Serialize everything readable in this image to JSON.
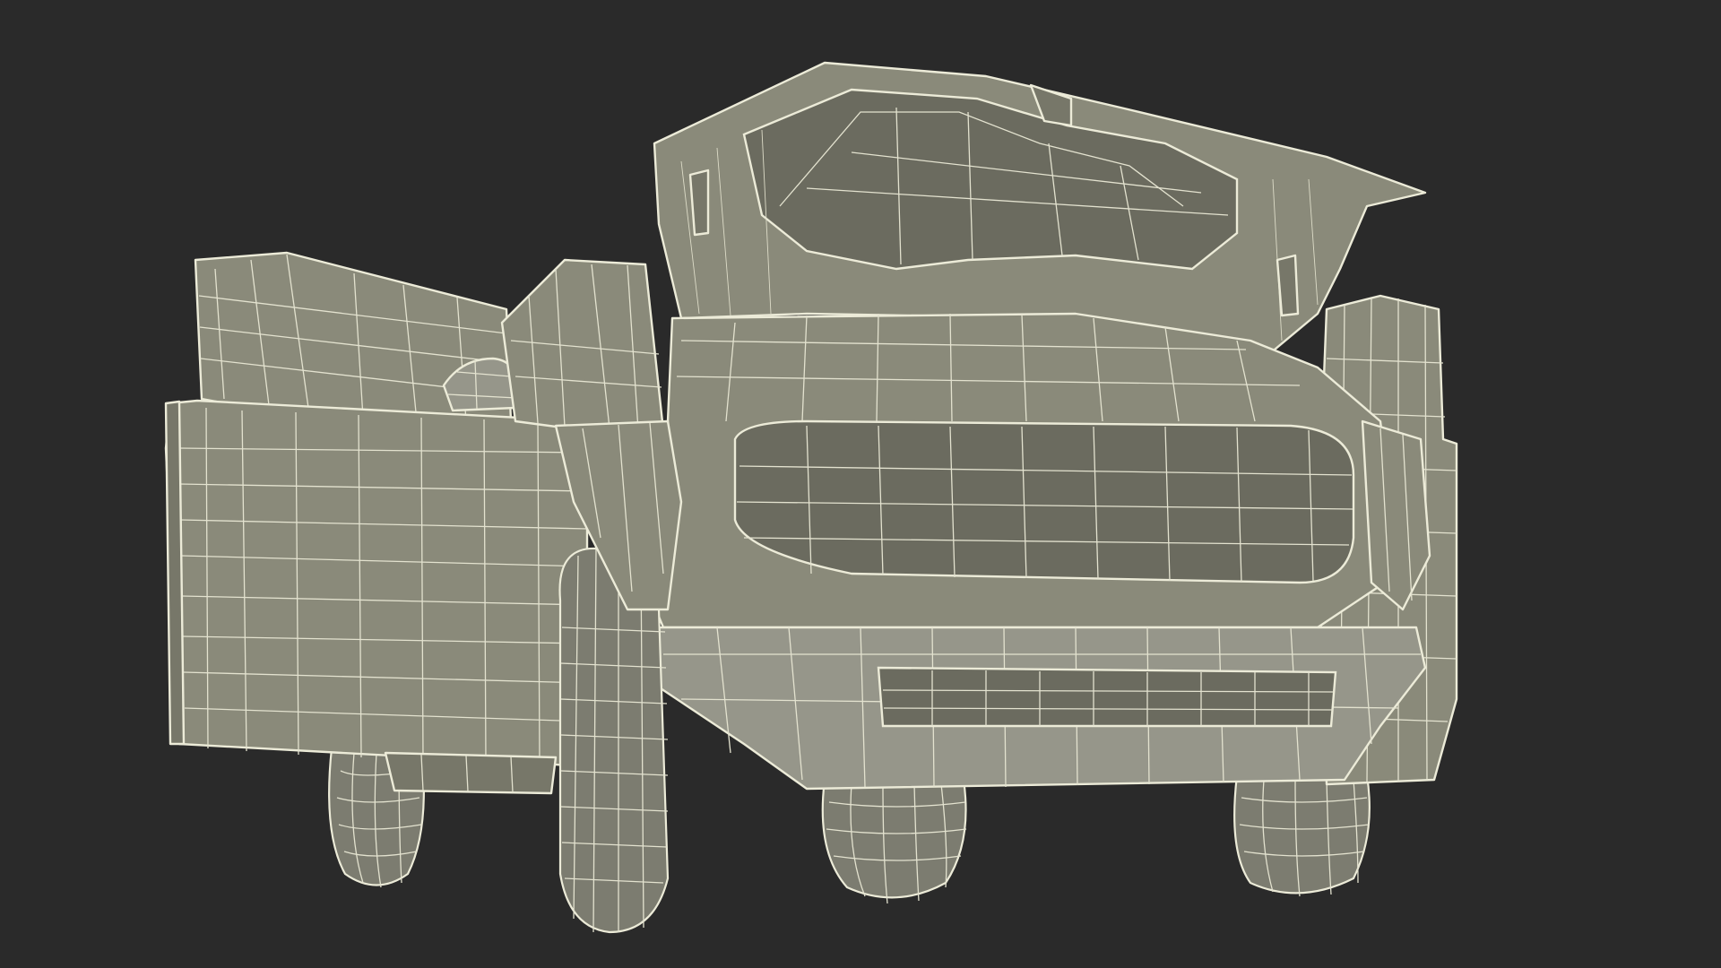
{
  "scene": {
    "background_color": "#2a2a2a",
    "model_fill_color": "#8a8a7a",
    "wire_color": "#ecebd8",
    "render_style": "wireframe-on-shaded",
    "subject": "car-front-view-doors-and-hood-open"
  }
}
